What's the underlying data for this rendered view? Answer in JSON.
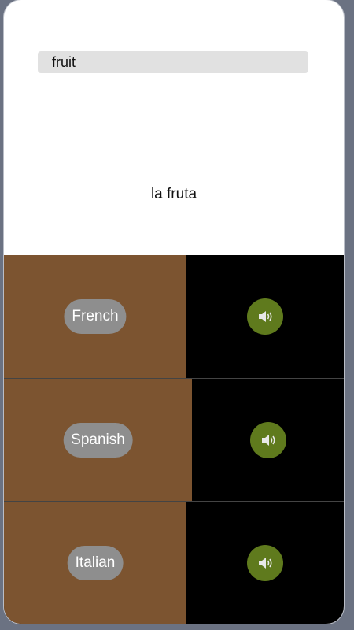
{
  "search": {
    "value": "fruit",
    "placeholder": ""
  },
  "translation": {
    "text": "la fruta"
  },
  "languages": [
    {
      "label": "French",
      "icon": "speaker-icon"
    },
    {
      "label": "Spanish",
      "icon": "speaker-icon"
    },
    {
      "label": "Italian",
      "icon": "speaker-icon"
    }
  ],
  "colors": {
    "language_pane": "#7c5430",
    "audio_pane": "#000000",
    "pill": "#8e8e8e",
    "speaker_button": "#5f7a1d"
  }
}
